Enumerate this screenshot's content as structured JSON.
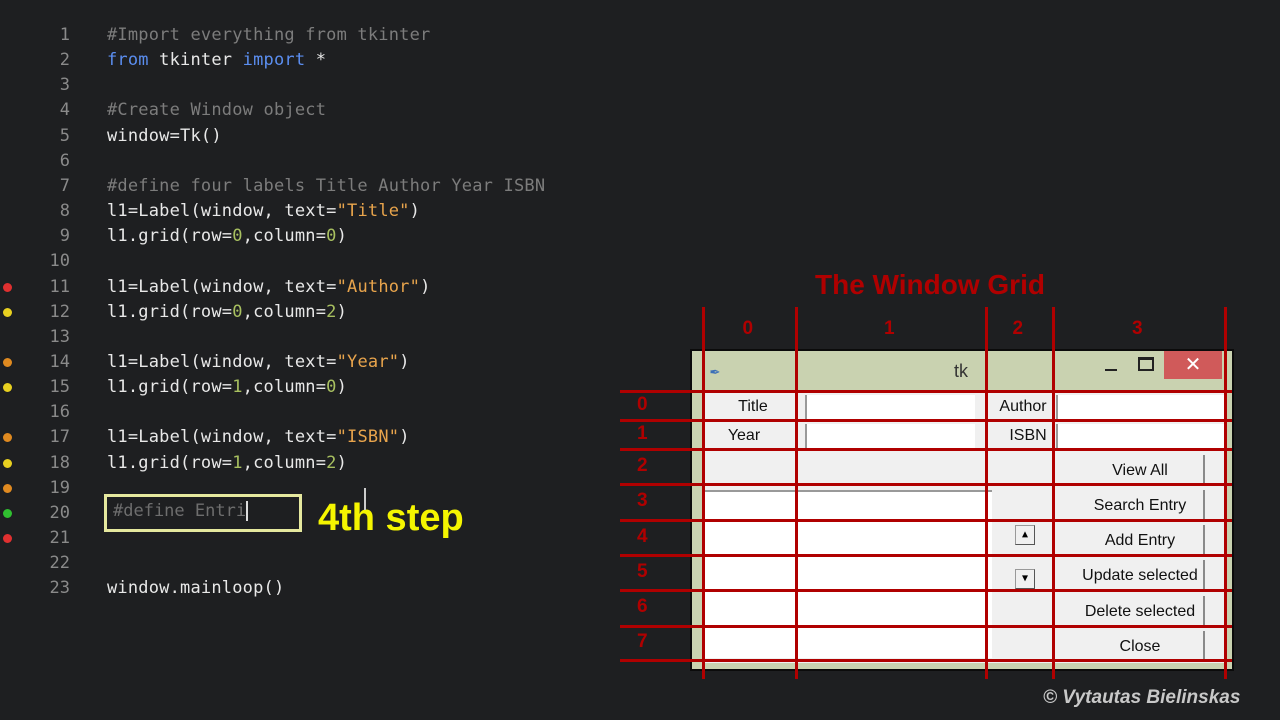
{
  "editor": {
    "lines": [
      {
        "n": "1",
        "tokens": [
          {
            "t": "#Import everything from tkinter",
            "c": "comment"
          }
        ]
      },
      {
        "n": "2",
        "tokens": [
          {
            "t": "from",
            "c": "kw"
          },
          {
            "t": " tkinter ",
            "c": "plain"
          },
          {
            "t": "import",
            "c": "kw"
          },
          {
            "t": " *",
            "c": "plain"
          }
        ]
      },
      {
        "n": "3",
        "tokens": []
      },
      {
        "n": "4",
        "tokens": [
          {
            "t": "#Create Window object",
            "c": "comment"
          }
        ]
      },
      {
        "n": "5",
        "tokens": [
          {
            "t": "window=Tk()",
            "c": "plain"
          }
        ]
      },
      {
        "n": "6",
        "tokens": []
      },
      {
        "n": "7",
        "tokens": [
          {
            "t": "#define four labels Title Author Year ISBN",
            "c": "comment"
          }
        ]
      },
      {
        "n": "8",
        "tokens": [
          {
            "t": "l1=Label(window, text=",
            "c": "plain"
          },
          {
            "t": "\"Title\"",
            "c": "str"
          },
          {
            "t": ")",
            "c": "plain"
          }
        ]
      },
      {
        "n": "9",
        "tokens": [
          {
            "t": "l1.grid(row=",
            "c": "plain"
          },
          {
            "t": "0",
            "c": "num"
          },
          {
            "t": ",column=",
            "c": "plain"
          },
          {
            "t": "0",
            "c": "num"
          },
          {
            "t": ")",
            "c": "plain"
          }
        ]
      },
      {
        "n": "10",
        "tokens": []
      },
      {
        "n": "11",
        "dot": "#e03030",
        "tokens": [
          {
            "t": "l1=Label(window, text=",
            "c": "plain"
          },
          {
            "t": "\"Author\"",
            "c": "str"
          },
          {
            "t": ")",
            "c": "plain"
          }
        ]
      },
      {
        "n": "12",
        "dot": "#e8d020",
        "tokens": [
          {
            "t": "l1.grid(row=",
            "c": "plain"
          },
          {
            "t": "0",
            "c": "num"
          },
          {
            "t": ",column=",
            "c": "plain"
          },
          {
            "t": "2",
            "c": "num"
          },
          {
            "t": ")",
            "c": "plain"
          }
        ]
      },
      {
        "n": "13",
        "tokens": []
      },
      {
        "n": "14",
        "dot": "#e08a20",
        "tokens": [
          {
            "t": "l1=Label(window, text=",
            "c": "plain"
          },
          {
            "t": "\"Year\"",
            "c": "str"
          },
          {
            "t": ")",
            "c": "plain"
          }
        ]
      },
      {
        "n": "15",
        "dot": "#e8d020",
        "tokens": [
          {
            "t": "l1.grid(row=",
            "c": "plain"
          },
          {
            "t": "1",
            "c": "num"
          },
          {
            "t": ",column=",
            "c": "plain"
          },
          {
            "t": "0",
            "c": "num"
          },
          {
            "t": ")",
            "c": "plain"
          }
        ]
      },
      {
        "n": "16",
        "tokens": []
      },
      {
        "n": "17",
        "dot": "#e08a20",
        "tokens": [
          {
            "t": "l1=Label(window, text=",
            "c": "plain"
          },
          {
            "t": "\"ISBN\"",
            "c": "str"
          },
          {
            "t": ")",
            "c": "plain"
          }
        ]
      },
      {
        "n": "18",
        "dot": "#e8d020",
        "tokens": [
          {
            "t": "l1.grid(row=",
            "c": "plain"
          },
          {
            "t": "1",
            "c": "num"
          },
          {
            "t": ",column=",
            "c": "plain"
          },
          {
            "t": "2",
            "c": "num"
          },
          {
            "t": ")",
            "c": "plain"
          }
        ]
      },
      {
        "n": "19",
        "dot": "#e08a20",
        "tokens": []
      },
      {
        "n": "20",
        "dot": "#30c030",
        "tokens": []
      },
      {
        "n": "21",
        "dot": "#e03030",
        "tokens": []
      },
      {
        "n": "22",
        "tokens": []
      },
      {
        "n": "23",
        "tokens": [
          {
            "t": "window.mainloop()",
            "c": "plain"
          }
        ]
      }
    ],
    "typing_text": "#define Entri",
    "step_label": "4th step"
  },
  "grid_overlay": {
    "title": "The Window Grid",
    "columns": [
      "0",
      "1",
      "2",
      "3"
    ],
    "rows": [
      "0",
      "1",
      "2",
      "3",
      "4",
      "5",
      "6",
      "7"
    ]
  },
  "tk_window": {
    "title": "tk",
    "close_glyph": "✕",
    "labels": {
      "title": "Title",
      "author": "Author",
      "year": "Year",
      "isbn": "ISBN"
    },
    "buttons": [
      "View All",
      "Search Entry",
      "Add Entry",
      "Update selected",
      "Delete selected",
      "Close"
    ],
    "scroll_up": "▲",
    "scroll_down": "▼"
  },
  "copyright": "© Vytautas Bielinskas"
}
